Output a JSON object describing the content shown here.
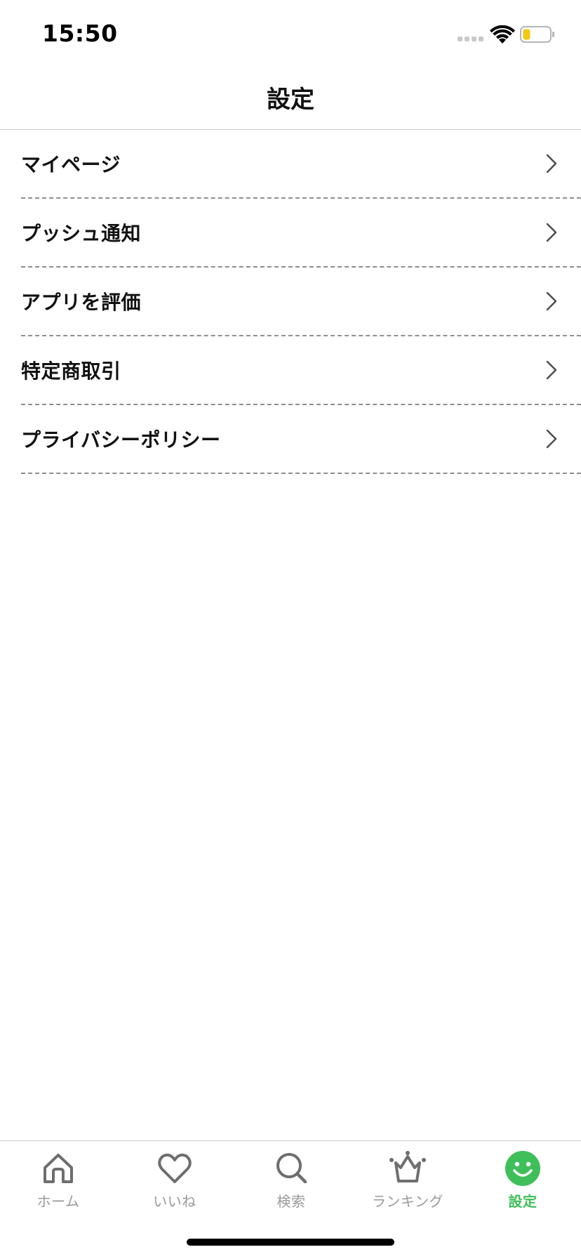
{
  "status_bar": {
    "time": "15:50"
  },
  "nav": {
    "title": "設定"
  },
  "menu": {
    "items": [
      {
        "label": "マイページ"
      },
      {
        "label": "プッシュ通知"
      },
      {
        "label": "アプリを評価"
      },
      {
        "label": "特定商取引"
      },
      {
        "label": "プライバシーポリシー"
      }
    ]
  },
  "tab_bar": {
    "tabs": [
      {
        "label": "ホーム",
        "icon": "home-icon"
      },
      {
        "label": "いいね",
        "icon": "heart-icon"
      },
      {
        "label": "検索",
        "icon": "search-icon"
      },
      {
        "label": "ランキング",
        "icon": "crown-icon"
      },
      {
        "label": "設定",
        "icon": "smiley-icon",
        "active": true
      }
    ],
    "active_color": "#3fbf5a",
    "inactive_color": "#9a9a9a"
  }
}
